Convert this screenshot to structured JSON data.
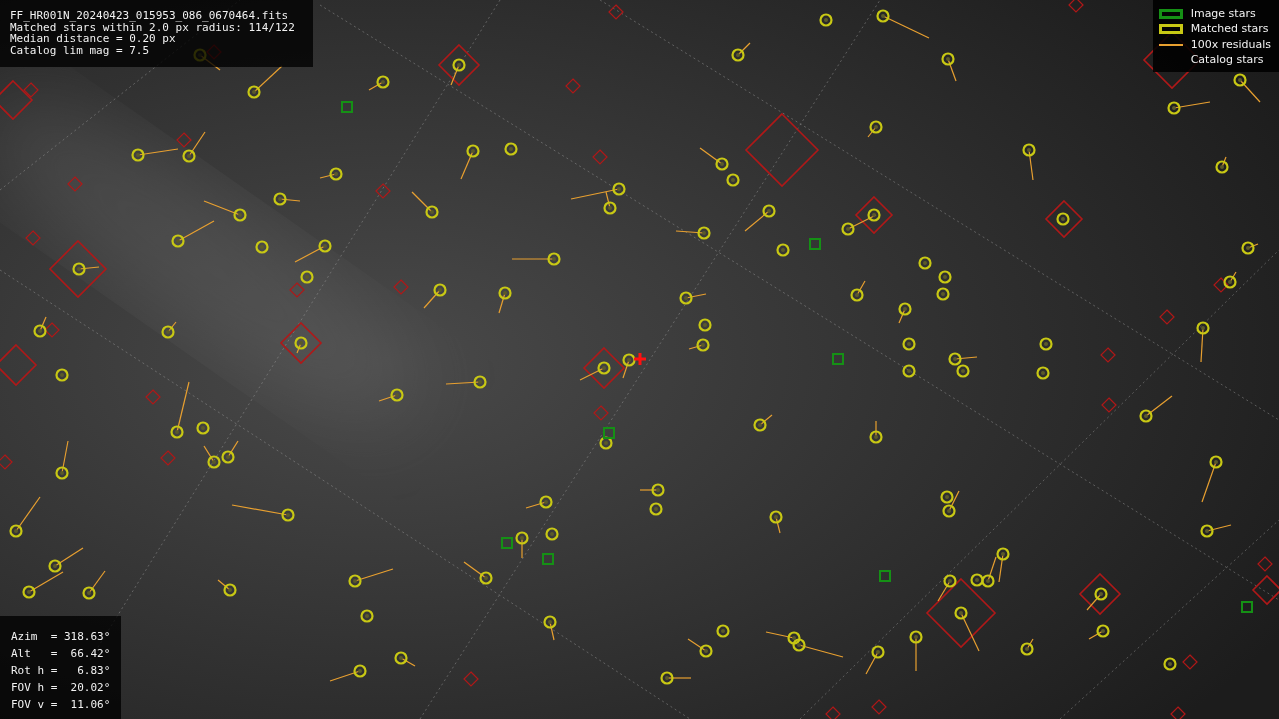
{
  "file_info": {
    "lines": [
      "FF_HR001N_20240423_015953_086_0670464.fits",
      "Matched stars within 2.0 px radius: 114/122",
      "Median distance = 0.20 px",
      "Catalog lim mag = 7.5"
    ]
  },
  "legend": {
    "items": [
      {
        "label": "Image stars",
        "kind": "rect",
        "color": "#159015"
      },
      {
        "label": "Matched stars",
        "kind": "rect",
        "color": "#c8c814"
      },
      {
        "label": "100x residuals",
        "kind": "line",
        "color": "#e8a030"
      },
      {
        "label": "Catalog stars",
        "kind": "none"
      }
    ]
  },
  "pointing": {
    "lines": [
      "Azim  = 318.63°",
      "Alt   =  66.42°",
      "Rot h =   6.83°",
      "FOV h =  20.02°",
      "FOV v =  11.06°"
    ]
  }
}
